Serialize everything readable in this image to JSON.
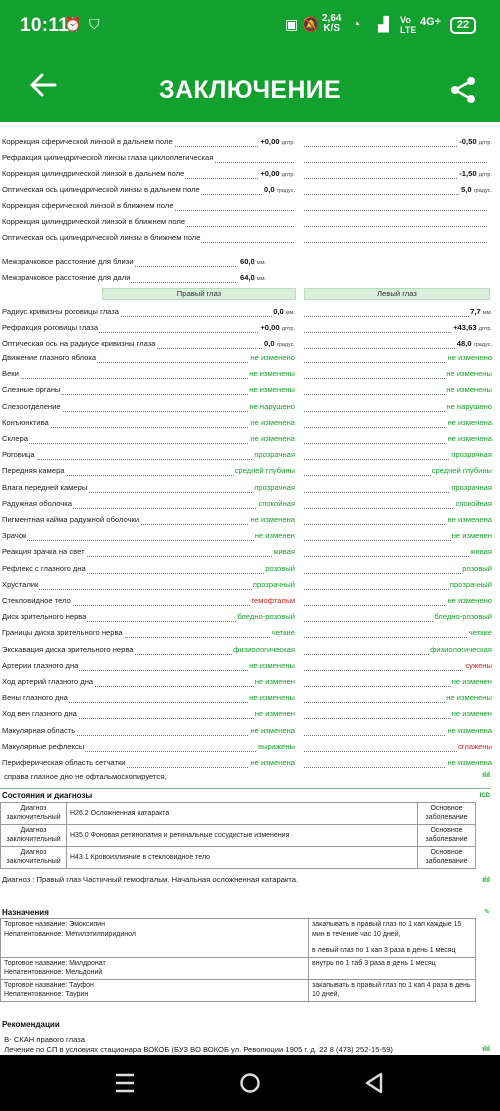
{
  "status": {
    "time": "10:11",
    "net_speed": "2,64",
    "net_unit": "K/S",
    "vo": "Vo",
    "lte_small": "LTE",
    "lte": "4G+",
    "battery": "22"
  },
  "appbar": {
    "title": "ЗАКЛЮЧЕНИЕ"
  },
  "refraction": [
    {
      "label": "Коррекция сферической линзой в дальнем поле",
      "r": "+0,00",
      "ru": "дптр.",
      "l": "-0,50",
      "lu": "дптр."
    },
    {
      "label": "Рефракция цилиндрической линзы глаза циклоплегическая",
      "r": "",
      "ru": "",
      "l": "",
      "lu": ""
    },
    {
      "label": "Коррекция цилиндрической линзой в дальнем поле",
      "r": "+0,00",
      "ru": "дптр.",
      "l": "-1,50",
      "lu": "дптр."
    },
    {
      "label": "Оптическая ось цилиндрической линзы в дальнем поле",
      "r": "0,0",
      "ru": "градус.",
      "l": "5,0",
      "lu": "градус."
    },
    {
      "label": "Коррекция сферической линзой в ближнем поле",
      "r": "",
      "ru": "",
      "l": "",
      "lu": ""
    },
    {
      "label": "Коррекция цилиндрической линзой в ближнем поле",
      "r": "",
      "ru": "",
      "l": "",
      "lu": ""
    },
    {
      "label": "Оптическая ось цилиндрической линзы в ближнем поле",
      "r": "",
      "ru": "",
      "l": "",
      "lu": ""
    }
  ],
  "pd": [
    {
      "label": "Межзрачковое расстояние для близи",
      "value": "60,0",
      "unit": "мм."
    },
    {
      "label": "Межзрачковое расстояние для дали",
      "value": "64,0",
      "unit": "мм."
    }
  ],
  "eyes": {
    "right": "Правый глаз",
    "left": "Левый глаз"
  },
  "cornea": [
    {
      "label": "Радиус кривизны роговицы глаза",
      "r": "0,0",
      "ru": "мм.",
      "l": "7,7",
      "lu": "мм."
    },
    {
      "label": "Рефракция роговицы глаза",
      "r": "+0,00",
      "ru": "дптр.",
      "l": "+43,63",
      "lu": "дптр."
    },
    {
      "label": "Оптическая ось на радиусе кривизны глаза",
      "r": "0,0",
      "ru": "градус.",
      "l": "48,0",
      "lu": "градус."
    }
  ],
  "findings": [
    {
      "label": "Движение глазного яблока",
      "r": "не изменено",
      "l": "не изменено"
    },
    {
      "label": "Веки",
      "r": "не изменены",
      "l": "не изменены"
    },
    {
      "label": "Слезные органы",
      "r": "не изменены",
      "l": "не изменены"
    },
    {
      "label": "Слезоотделение",
      "r": "не нарушено",
      "l": "не нарушено"
    },
    {
      "label": "Конъюнктива",
      "r": "не изменена",
      "l": "не изменена"
    },
    {
      "label": "Склера",
      "r": "не изменена",
      "l": "не изменена"
    },
    {
      "label": "Роговица",
      "r": "прозрачная",
      "l": "прозрачная"
    },
    {
      "label": "Передняя камера",
      "r": "средней глубины",
      "l": "средней глубины"
    },
    {
      "label": "Влага передней камеры",
      "r": "прозрачная",
      "l": "прозрачная"
    },
    {
      "label": "Радужная оболочка",
      "r": "спокойная",
      "l": "спокойная"
    },
    {
      "label": "Пигментная кайма радужной оболочки",
      "r": "не изменена",
      "l": "не изменена"
    },
    {
      "label": "Зрачок",
      "r": "не изменен",
      "l": "не изменен"
    },
    {
      "label": "Реакция зрачка на свет",
      "r": "живая",
      "l": "живая"
    },
    {
      "label": "Рефлекс с глазного дна",
      "r": "розовый",
      "l": "розовый"
    },
    {
      "label": "Хрусталик",
      "r": "прозрачный",
      "l": "прозрачный"
    },
    {
      "label": "Стекловидное тело",
      "r": "гемофтальм",
      "l": "не изменено",
      "rred": true
    },
    {
      "label": "Диск зрительного нерва",
      "r": "бледно-розовый",
      "l": "бледно-розовый"
    },
    {
      "label": "Границы диска зрительного нерва",
      "r": "четкие",
      "l": "четкие"
    },
    {
      "label": "Экскавация диска зрительного нерва",
      "r": "физиологическая",
      "l": "физиологическая"
    },
    {
      "label": "Артерии глазного дна",
      "r": "не изменены",
      "l": "сужены",
      "lred": true
    },
    {
      "label": "Ход артерий глазного дна",
      "r": "не изменен",
      "l": "не изменен"
    },
    {
      "label": "Вены глазного дна",
      "r": "не изменены",
      "l": "не изменены"
    },
    {
      "label": "Ход вен глазного дна",
      "r": "не изменен",
      "l": "не изменен"
    },
    {
      "label": "Макулярная область",
      "r": "не изменена",
      "l": "не изменена"
    },
    {
      "label": "Макулярные рефлексы",
      "r": "выражены",
      "l": "сглажены",
      "lred": true
    },
    {
      "label": "Периферическая область сетчатки",
      "r": "не изменена",
      "l": "не изменена"
    }
  ],
  "note": "справа глазное дно не офтальмоскопируется,",
  "states": {
    "title": "Состояния и диагнозы",
    "icd": "ICD",
    "rows": [
      {
        "kind": "Диагноз заключительный",
        "text": "H26.2 Осложненная катаракта",
        "type": "Основное заболевание"
      },
      {
        "kind": "Диагноз заключительный",
        "text": "H35.0 Фоновая ретинопатия и ретинальные сосудистые изменения",
        "type": "Основное заболевание"
      },
      {
        "kind": "Диагноз заключительный",
        "text": "H43.1 Кровоизлияние в стекловидное тело",
        "type": "Основное заболевание"
      }
    ]
  },
  "diagnosis": "Диагноз : Правый глаз Частичный гемофтальм. Начальная осложненная катаракта.",
  "prescriptions": {
    "title": "Назначения",
    "trade_label": "Торговое название:",
    "inn_label": "Непатентованное:",
    "rows": [
      {
        "trade": "Эмоксипин",
        "inn": "Метилэтилпиридинол",
        "dose1": "закапывать в правый глаз по 1 кап каждые 15 мин в течение час 10 дней,",
        "dose2": "в левый глаз по 1 кап 3 раза в день 1 месяц"
      },
      {
        "trade": "Милдронат",
        "inn": "Мельдоний",
        "dose1": "внутрь по 1 таб 3 раза в день 1 месяц",
        "dose2": ""
      },
      {
        "trade": "Тауфон",
        "inn": "Таурин",
        "dose1": "закапывать в правый глаз по 1 кап 4 раза в день 10 дней,",
        "dose2": ""
      }
    ]
  },
  "recommendations": {
    "title": "Рекомендации",
    "line1": "В- СКАН правого глаза",
    "line2": "Лечение по СП в условиях стационара ВОКОБ (БУЗ ВО ВОКОБ ул. Революции 1905 г. д. 22 8 (473) 252-15-59)"
  },
  "colors": {
    "brand": "#12a02e",
    "ok": "#17a32b",
    "alert": "#e02020"
  }
}
